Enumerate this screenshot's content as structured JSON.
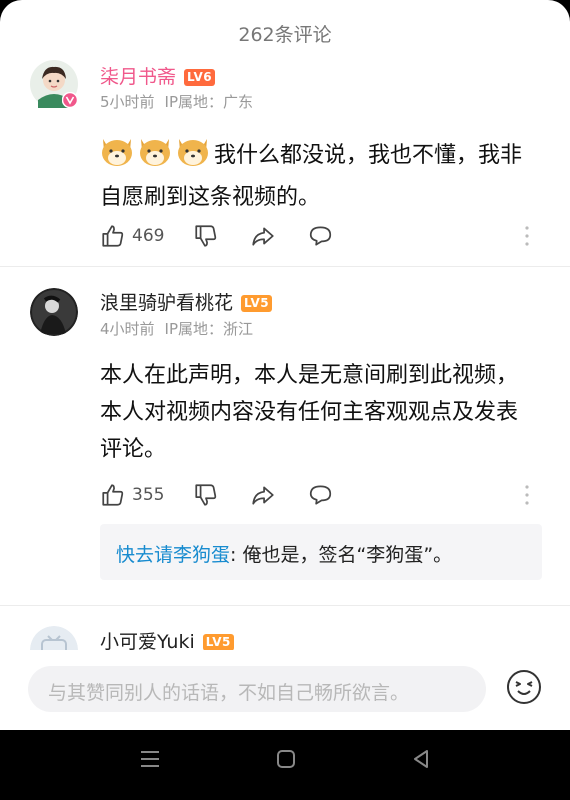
{
  "header": {
    "title": "262条评论"
  },
  "comments": [
    {
      "author": "柒月书斋",
      "level": "LV6",
      "time": "5小时前",
      "ip": "IP属地：广东",
      "text": "我什么都没说，我也不懂，我非自愿刷到这条视频的。",
      "likes": "469"
    },
    {
      "author": "浪里骑驴看桃花",
      "level": "LV5",
      "time": "4小时前",
      "ip": "IP属地：浙江",
      "text": "本人在此声明，本人是无意间刷到此视频，本人对视频内容没有任何主客观观点及发表评论。",
      "likes": "355",
      "reply": {
        "author": "快去请李狗蛋",
        "separator": ": ",
        "text": "俺也是，签名“李狗蛋”。"
      }
    },
    {
      "author": "小可爱Yuki",
      "level": "LV5"
    }
  ],
  "input": {
    "placeholder": "与其赞同别人的话语，不如自己畅所欲言。"
  },
  "icons": {
    "like": "thumb-up-icon",
    "dislike": "thumb-down-icon",
    "share": "share-icon",
    "reply": "comment-bubble-icon",
    "more": "more-vertical-icon",
    "emoji": "emoji-icon",
    "menu": "menu-icon",
    "home": "home-icon",
    "back": "back-icon"
  },
  "colors": {
    "vip_name": "#f0588b",
    "lv6": "#ff6a3d",
    "lv5": "#ff9b2f",
    "reply_author": "#178bcf"
  }
}
